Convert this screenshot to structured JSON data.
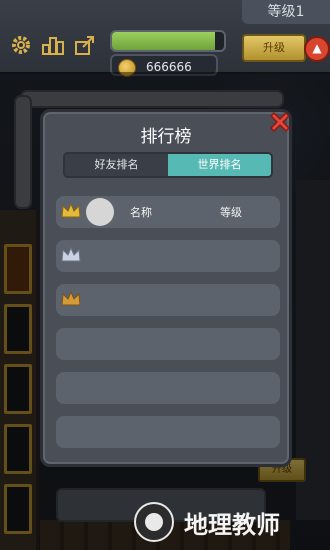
{
  "header": {
    "level_label": "等级1",
    "coins": "666666",
    "upgrade_label": "升级",
    "progress": 0.92
  },
  "icons": [
    "gear-icon",
    "podium-icon",
    "share-icon"
  ],
  "modal": {
    "title": "排行榜",
    "tabs": [
      {
        "label": "好友排名",
        "active": false
      },
      {
        "label": "世界排名",
        "active": true
      }
    ],
    "header_row": {
      "name_col": "名称",
      "level_col": "等级"
    },
    "rows": [
      {
        "crown": "gold"
      },
      {
        "crown": "silver"
      },
      {
        "crown": "bronze"
      },
      {
        "crown": ""
      },
      {
        "crown": ""
      },
      {
        "crown": ""
      }
    ]
  },
  "bottom": {
    "upgrade_label": "升级"
  },
  "watermark": {
    "text": "地理教师"
  },
  "colors": {
    "accent": "#57b9b3",
    "modal_bg": "#494e57",
    "row_bg": "#5d636d",
    "close_red": "#e2483c"
  }
}
